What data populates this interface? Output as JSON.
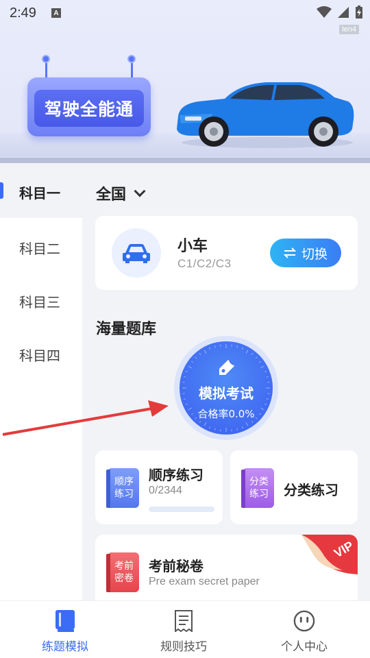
{
  "status_bar": {
    "time": "2:49",
    "notif_icon": "A",
    "device_tag": "len4"
  },
  "banner": {
    "sign_text": "驾驶全能通"
  },
  "left_nav": {
    "items": [
      {
        "label": "科目一",
        "active": true
      },
      {
        "label": "科目二",
        "active": false
      },
      {
        "label": "科目三",
        "active": false
      },
      {
        "label": "科目四",
        "active": false
      }
    ]
  },
  "region": {
    "label": "全国"
  },
  "vehicle_card": {
    "title": "小车",
    "subtitle": "C1/C2/C3",
    "switch_label": "切换"
  },
  "question_bank": {
    "title": "海量题库"
  },
  "mock_exam": {
    "title": "模拟考试",
    "pass_rate": "合格率0.0%"
  },
  "sequential_practice": {
    "book_text": "顺序练习",
    "title": "顺序练习",
    "progress": "0/2344",
    "progress_fraction": 0
  },
  "category_practice": {
    "book_text": "分类练习",
    "title": "分类练习"
  },
  "secret_paper": {
    "book_text": "考前密卷",
    "title": "考前秘卷",
    "subtitle": "Pre exam secret paper",
    "badge": "VIP"
  },
  "tabs": [
    {
      "label": "练题模拟",
      "icon": "book-icon",
      "active": true
    },
    {
      "label": "规则技巧",
      "icon": "document-icon",
      "active": false
    },
    {
      "label": "个人中心",
      "icon": "profile-face-icon",
      "active": false
    }
  ],
  "colors": {
    "accent": "#3a6cf5",
    "active_tab": "#3a6cf5",
    "vip": "#e5393f"
  }
}
